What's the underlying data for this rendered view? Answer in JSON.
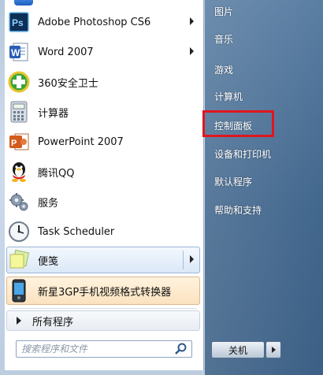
{
  "programs": [
    {
      "label": "Adobe Photoshop CS6",
      "icon": "photoshop-icon",
      "submenu": true
    },
    {
      "label": "Word 2007",
      "icon": "word-icon",
      "submenu": true
    },
    {
      "label": "360安全卫士",
      "icon": "360-safeguard-icon",
      "submenu": false
    },
    {
      "label": "计算器",
      "icon": "calculator-icon",
      "submenu": false
    },
    {
      "label": "PowerPoint 2007",
      "icon": "powerpoint-icon",
      "submenu": false
    },
    {
      "label": "腾讯QQ",
      "icon": "qq-penguin-icon",
      "submenu": false
    },
    {
      "label": "服务",
      "icon": "services-gear-icon",
      "submenu": false
    },
    {
      "label": "Task Scheduler",
      "icon": "clock-icon",
      "submenu": false
    }
  ],
  "pinned": {
    "label": "便笺",
    "icon": "sticky-notes-icon"
  },
  "recent": {
    "label": "新星3GP手机视频格式转换器",
    "icon": "phone-video-icon"
  },
  "all_programs": "所有程序",
  "search": {
    "placeholder": "搜索程序和文件",
    "icon": "search-icon"
  },
  "right_items": [
    "图片",
    "音乐",
    "游戏",
    "计算机",
    "控制面板",
    "设备和打印机",
    "默认程序",
    "帮助和支持"
  ],
  "highlighted_item": "控制面板",
  "shutdown": {
    "label": "关机"
  },
  "colors": {
    "highlight_box": "#e0161f",
    "right_panel": "#42678d"
  }
}
